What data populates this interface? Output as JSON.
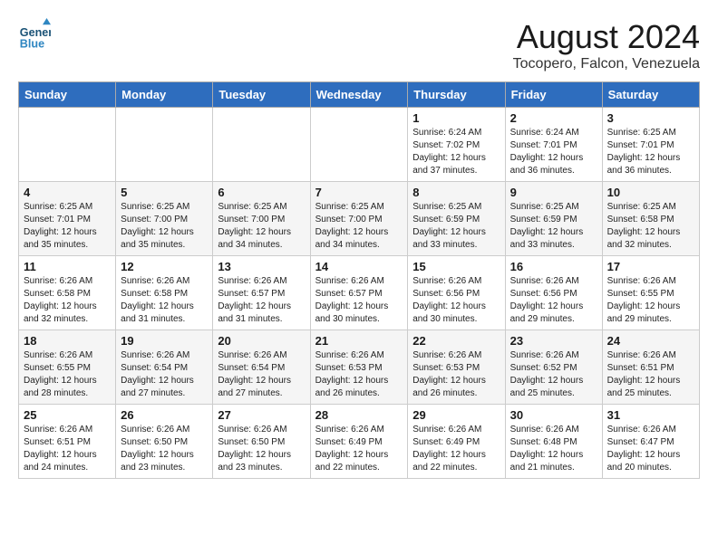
{
  "header": {
    "logo_line1": "General",
    "logo_line2": "Blue",
    "month_year": "August 2024",
    "location": "Tocopero, Falcon, Venezuela"
  },
  "days_of_week": [
    "Sunday",
    "Monday",
    "Tuesday",
    "Wednesday",
    "Thursday",
    "Friday",
    "Saturday"
  ],
  "weeks": [
    [
      {
        "day": "",
        "info": ""
      },
      {
        "day": "",
        "info": ""
      },
      {
        "day": "",
        "info": ""
      },
      {
        "day": "",
        "info": ""
      },
      {
        "day": "1",
        "info": "Sunrise: 6:24 AM\nSunset: 7:02 PM\nDaylight: 12 hours\nand 37 minutes."
      },
      {
        "day": "2",
        "info": "Sunrise: 6:24 AM\nSunset: 7:01 PM\nDaylight: 12 hours\nand 36 minutes."
      },
      {
        "day": "3",
        "info": "Sunrise: 6:25 AM\nSunset: 7:01 PM\nDaylight: 12 hours\nand 36 minutes."
      }
    ],
    [
      {
        "day": "4",
        "info": "Sunrise: 6:25 AM\nSunset: 7:01 PM\nDaylight: 12 hours\nand 35 minutes."
      },
      {
        "day": "5",
        "info": "Sunrise: 6:25 AM\nSunset: 7:00 PM\nDaylight: 12 hours\nand 35 minutes."
      },
      {
        "day": "6",
        "info": "Sunrise: 6:25 AM\nSunset: 7:00 PM\nDaylight: 12 hours\nand 34 minutes."
      },
      {
        "day": "7",
        "info": "Sunrise: 6:25 AM\nSunset: 7:00 PM\nDaylight: 12 hours\nand 34 minutes."
      },
      {
        "day": "8",
        "info": "Sunrise: 6:25 AM\nSunset: 6:59 PM\nDaylight: 12 hours\nand 33 minutes."
      },
      {
        "day": "9",
        "info": "Sunrise: 6:25 AM\nSunset: 6:59 PM\nDaylight: 12 hours\nand 33 minutes."
      },
      {
        "day": "10",
        "info": "Sunrise: 6:25 AM\nSunset: 6:58 PM\nDaylight: 12 hours\nand 32 minutes."
      }
    ],
    [
      {
        "day": "11",
        "info": "Sunrise: 6:26 AM\nSunset: 6:58 PM\nDaylight: 12 hours\nand 32 minutes."
      },
      {
        "day": "12",
        "info": "Sunrise: 6:26 AM\nSunset: 6:58 PM\nDaylight: 12 hours\nand 31 minutes."
      },
      {
        "day": "13",
        "info": "Sunrise: 6:26 AM\nSunset: 6:57 PM\nDaylight: 12 hours\nand 31 minutes."
      },
      {
        "day": "14",
        "info": "Sunrise: 6:26 AM\nSunset: 6:57 PM\nDaylight: 12 hours\nand 30 minutes."
      },
      {
        "day": "15",
        "info": "Sunrise: 6:26 AM\nSunset: 6:56 PM\nDaylight: 12 hours\nand 30 minutes."
      },
      {
        "day": "16",
        "info": "Sunrise: 6:26 AM\nSunset: 6:56 PM\nDaylight: 12 hours\nand 29 minutes."
      },
      {
        "day": "17",
        "info": "Sunrise: 6:26 AM\nSunset: 6:55 PM\nDaylight: 12 hours\nand 29 minutes."
      }
    ],
    [
      {
        "day": "18",
        "info": "Sunrise: 6:26 AM\nSunset: 6:55 PM\nDaylight: 12 hours\nand 28 minutes."
      },
      {
        "day": "19",
        "info": "Sunrise: 6:26 AM\nSunset: 6:54 PM\nDaylight: 12 hours\nand 27 minutes."
      },
      {
        "day": "20",
        "info": "Sunrise: 6:26 AM\nSunset: 6:54 PM\nDaylight: 12 hours\nand 27 minutes."
      },
      {
        "day": "21",
        "info": "Sunrise: 6:26 AM\nSunset: 6:53 PM\nDaylight: 12 hours\nand 26 minutes."
      },
      {
        "day": "22",
        "info": "Sunrise: 6:26 AM\nSunset: 6:53 PM\nDaylight: 12 hours\nand 26 minutes."
      },
      {
        "day": "23",
        "info": "Sunrise: 6:26 AM\nSunset: 6:52 PM\nDaylight: 12 hours\nand 25 minutes."
      },
      {
        "day": "24",
        "info": "Sunrise: 6:26 AM\nSunset: 6:51 PM\nDaylight: 12 hours\nand 25 minutes."
      }
    ],
    [
      {
        "day": "25",
        "info": "Sunrise: 6:26 AM\nSunset: 6:51 PM\nDaylight: 12 hours\nand 24 minutes."
      },
      {
        "day": "26",
        "info": "Sunrise: 6:26 AM\nSunset: 6:50 PM\nDaylight: 12 hours\nand 23 minutes."
      },
      {
        "day": "27",
        "info": "Sunrise: 6:26 AM\nSunset: 6:50 PM\nDaylight: 12 hours\nand 23 minutes."
      },
      {
        "day": "28",
        "info": "Sunrise: 6:26 AM\nSunset: 6:49 PM\nDaylight: 12 hours\nand 22 minutes."
      },
      {
        "day": "29",
        "info": "Sunrise: 6:26 AM\nSunset: 6:49 PM\nDaylight: 12 hours\nand 22 minutes."
      },
      {
        "day": "30",
        "info": "Sunrise: 6:26 AM\nSunset: 6:48 PM\nDaylight: 12 hours\nand 21 minutes."
      },
      {
        "day": "31",
        "info": "Sunrise: 6:26 AM\nSunset: 6:47 PM\nDaylight: 12 hours\nand 20 minutes."
      }
    ]
  ]
}
